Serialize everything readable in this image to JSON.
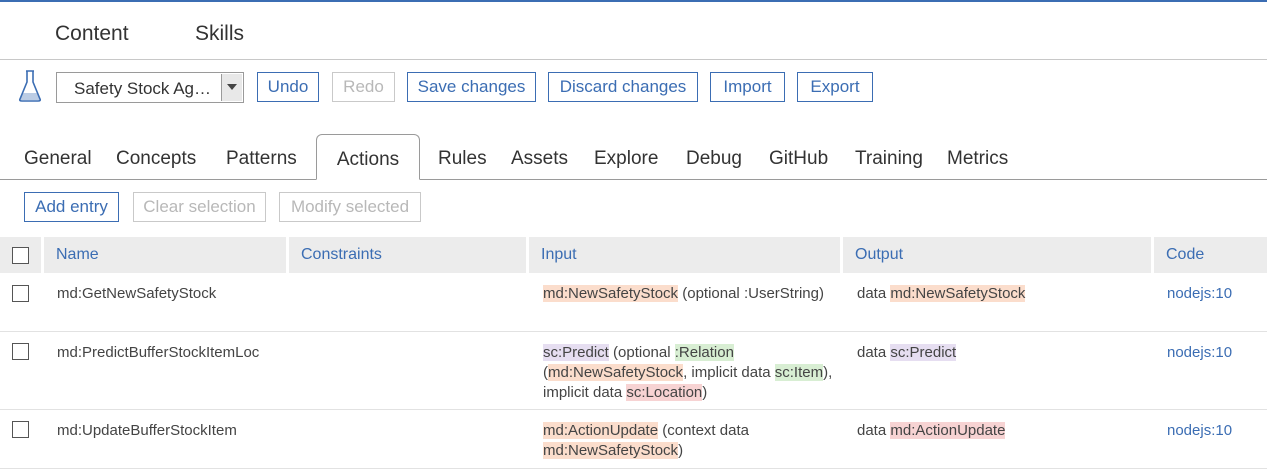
{
  "topnav": {
    "items": [
      "Content",
      "Skills"
    ]
  },
  "toolbar": {
    "flask_icon": "flask-icon",
    "skill_select": {
      "value": "Safety Stock Ag…"
    },
    "buttons": {
      "undo": "Undo",
      "redo": "Redo",
      "save": "Save changes",
      "discard": "Discard changes",
      "import": "Import",
      "export": "Export"
    }
  },
  "tabs": {
    "items": [
      "General",
      "Concepts",
      "Patterns",
      "Actions",
      "Rules",
      "Assets",
      "Explore",
      "Debug",
      "GitHub",
      "Training",
      "Metrics"
    ],
    "active": "Actions"
  },
  "entry_actions": {
    "add": "Add entry",
    "clear": "Clear selection",
    "modify": "Modify selected"
  },
  "table": {
    "columns": [
      "Name",
      "Constraints",
      "Input",
      "Output",
      "Code"
    ],
    "rows": [
      {
        "name": "md:GetNewSafetyStock",
        "constraints": "",
        "input": [
          {
            "text": "md:NewSafetyStock",
            "hl": "o"
          },
          {
            "text": " (optional "
          },
          {
            "text": ":UserString"
          },
          {
            "text": ")"
          }
        ],
        "output": [
          {
            "text": "data "
          },
          {
            "text": "md:NewSafetyStock",
            "hl": "o"
          }
        ],
        "code": "nodejs:10"
      },
      {
        "name": "md:PredictBufferStockItemLoc",
        "constraints": "",
        "input": [
          {
            "text": "sc:Predict",
            "hl": "p"
          },
          {
            "text": " (optional "
          },
          {
            "text": ":Relation",
            "hl": "g"
          },
          {
            "text": " ("
          },
          {
            "text": "md:NewSafetyStock",
            "hl": "o"
          },
          {
            "text": ", implicit data "
          },
          {
            "text": "sc:Item",
            "hl": "g"
          },
          {
            "text": "), implicit data "
          },
          {
            "text": "sc:Location",
            "hl": "r"
          },
          {
            "text": ")"
          }
        ],
        "output": [
          {
            "text": "data "
          },
          {
            "text": "sc:Predict",
            "hl": "p"
          }
        ],
        "code": "nodejs:10"
      },
      {
        "name": "md:UpdateBufferStockItem",
        "constraints": "",
        "input": [
          {
            "text": "md:ActionUpdate",
            "hl": "o"
          },
          {
            "text": " (context data "
          },
          {
            "text": "md:NewSafetyStock",
            "hl": "o"
          },
          {
            "text": ")"
          }
        ],
        "output": [
          {
            "text": "data "
          },
          {
            "text": "md:ActionUpdate",
            "hl": "r"
          }
        ],
        "code": "nodejs:10"
      }
    ]
  },
  "colors": {
    "accent": "#3b6db3",
    "highlight_orange": "#fbddcc",
    "highlight_purple": "#e6def1",
    "highlight_green": "#d8eed3",
    "highlight_red": "#f7d3d3"
  }
}
